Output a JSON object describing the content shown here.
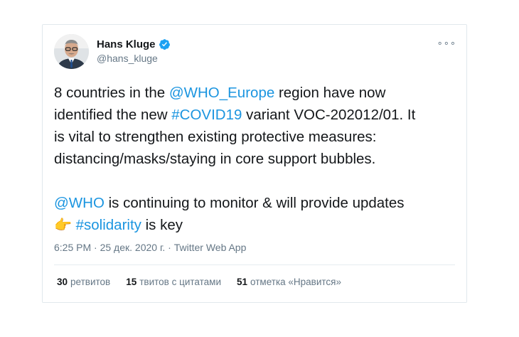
{
  "user": {
    "display_name": "Hans Kluge",
    "handle": "@hans_kluge"
  },
  "menu": {
    "more_label": "∘∘∘"
  },
  "tweet": {
    "line1_a": "8 countries in the ",
    "mention_who_europe": "@WHO_Europe",
    "line1_b": " region have now\nidentified the new ",
    "hashtag_covid": "#COVID19",
    "line1_c": " variant VOC-202012/01. It\nis vital to strengthen existing protective measures:\ndistancing/masks/staying in core support bubbles.\n\n",
    "mention_who": "@WHO",
    "line2_a": " is continuing to monitor & will provide updates\n",
    "emoji": "👉",
    "line2_b": " ",
    "hashtag_solidarity": "#solidarity",
    "line2_c": " is key"
  },
  "meta": {
    "time": "6:25 PM",
    "sep1": " · ",
    "date": "25 дек. 2020 г.",
    "sep2": " · ",
    "source": "Twitter Web App"
  },
  "stats": {
    "retweets_count": "30",
    "retweets_label": "ретвитов",
    "quotes_count": "15",
    "quotes_label": "твитов с цитатами",
    "likes_count": "51",
    "likes_label": "отметка «Нравится»"
  },
  "colors": {
    "link": "#1b95e0",
    "verified": "#1da1f2",
    "secondary_text": "#657786"
  },
  "icons": {
    "verified": "verified-badge-icon",
    "more": "more-options-icon"
  }
}
